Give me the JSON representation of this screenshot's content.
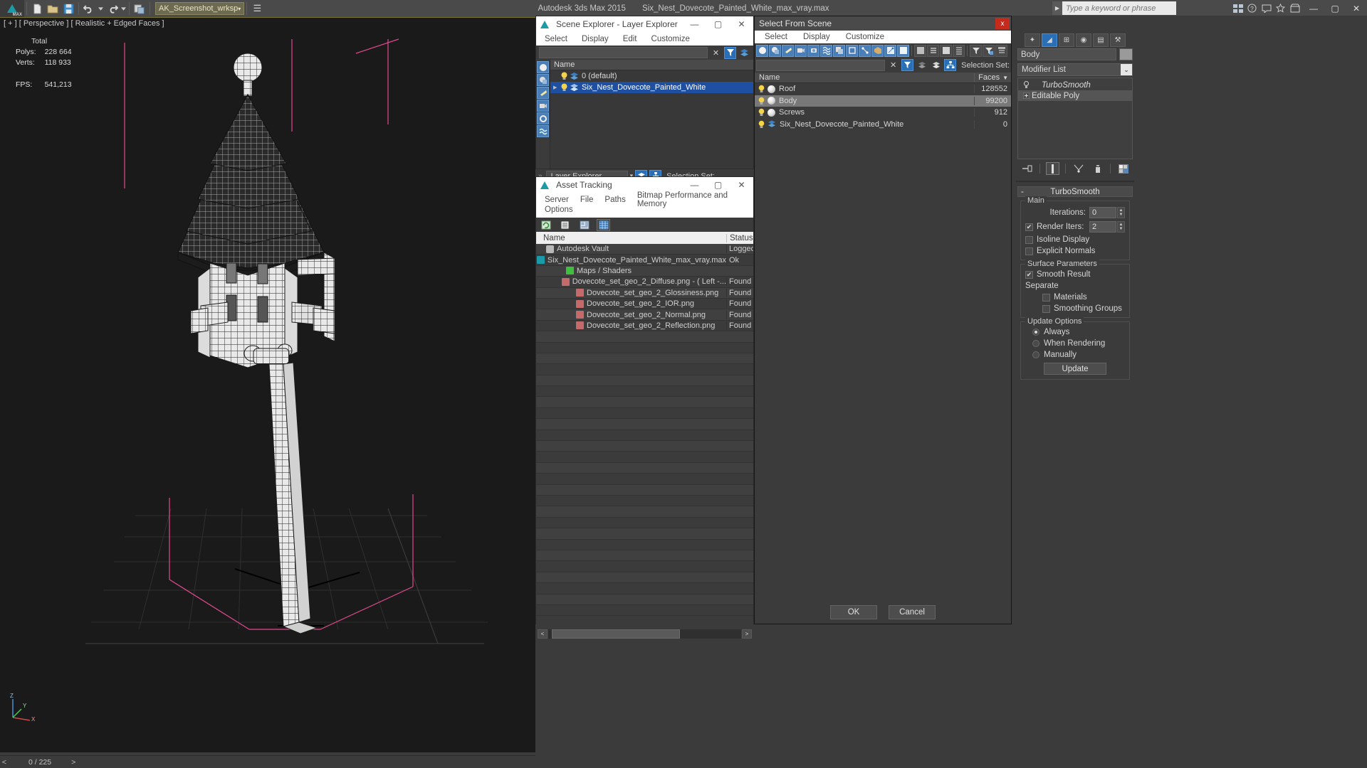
{
  "topbar": {
    "app_logo": "3dsmax-logo-icon",
    "quick_icons": [
      "new-file-icon",
      "open-file-icon",
      "save-file-icon",
      "undo-icon",
      "undo-dropdown-icon",
      "redo-icon",
      "redo-dropdown-icon",
      "select-link-icon"
    ],
    "workspace": "AK_Screenshot_wrksp",
    "title_app": "Autodesk 3ds Max  2015",
    "title_file": "Six_Nest_Dovecote_Painted_White_max_vray.max",
    "search_placeholder": "Type a keyword or phrase",
    "right_icons": [
      "workspaces-icon",
      "help-icon",
      "communication-center-icon",
      "favorites-icon",
      "exchange-store-icon"
    ],
    "window_controls": [
      "minimize-icon",
      "maximize-icon",
      "close-icon"
    ]
  },
  "viewport": {
    "label": "[ + ] [ Perspective ] [ Realistic + Edged Faces ]",
    "stats_header": "Total",
    "stats": [
      {
        "key": "Polys:",
        "value": "228 664"
      },
      {
        "key": "Verts:",
        "value": "118 933"
      },
      {
        "key": "FPS:",
        "value": "541,213"
      }
    ],
    "axis": {
      "z": "Z",
      "y": "Y",
      "x": "X"
    }
  },
  "statusbar": {
    "left_arrow": "<",
    "frame_counter": "0 / 225",
    "right_arrow": ">"
  },
  "scene_explorer": {
    "title": "Scene Explorer - Layer Explorer",
    "icon": "3dsmax-window-icon",
    "menus": [
      "Select",
      "Display",
      "Edit",
      "Customize"
    ],
    "toolbar_icons": [
      "clear-search-icon",
      "filter-icon",
      "layers-icon"
    ],
    "window_controls": [
      "minimize-icon",
      "maximize-icon",
      "close-icon"
    ],
    "rail_icons": [
      "geometry-filter-icon",
      "shapes-filter-icon",
      "lights-filter-icon",
      "cameras-filter-icon",
      "helpers-filter-icon",
      "spacewarps-filter-icon"
    ],
    "column_header": "Name",
    "rows": [
      {
        "name": "0 (default)",
        "selected": false,
        "expandable": false
      },
      {
        "name": "Six_Nest_Dovecote_Painted_White",
        "selected": true,
        "expandable": true
      }
    ],
    "footer_tab": "Layer Explorer",
    "footer_icons": [
      "layers-icon",
      "hierarchy-icon"
    ],
    "selection_set_label": "Selection Set:"
  },
  "asset_tracking": {
    "title": "Asset Tracking",
    "icon": "3dsmax-window-icon",
    "menus": [
      "Server",
      "File",
      "Paths",
      "Bitmap Performance and Memory",
      "Options"
    ],
    "window_controls": [
      "minimize-icon",
      "maximize-icon",
      "close-icon"
    ],
    "toolbar_icons": [
      "refresh-icon",
      "list-view-icon",
      "thumbnail-view-icon",
      "grid-view-icon"
    ],
    "columns": [
      "Name",
      "Status"
    ],
    "rows": [
      {
        "name": "Autodesk Vault",
        "status": "Logged",
        "indent": 1,
        "icon": "vault-icon",
        "icon_color": "#b8b8b8"
      },
      {
        "name": "Six_Nest_Dovecote_Painted_White_max_vray.max",
        "status": "Ok",
        "indent": 2,
        "icon": "max-file-icon",
        "icon_color": "#1b9aa8"
      },
      {
        "name": "Maps / Shaders",
        "status": "",
        "indent": 3,
        "icon": "maps-icon",
        "icon_color": "#3ec03e"
      },
      {
        "name": "Dovecote_set_geo_2_Diffuse.png -  ( Left -...",
        "status": "Found",
        "indent": 4,
        "icon": "bitmap-icon",
        "icon_color": "#c46a6a"
      },
      {
        "name": "Dovecote_set_geo_2_Glossiness.png",
        "status": "Found",
        "indent": 4,
        "icon": "bitmap-icon",
        "icon_color": "#c46a6a"
      },
      {
        "name": "Dovecote_set_geo_2_IOR.png",
        "status": "Found",
        "indent": 4,
        "icon": "bitmap-icon",
        "icon_color": "#c46a6a"
      },
      {
        "name": "Dovecote_set_geo_2_Normal.png",
        "status": "Found",
        "indent": 4,
        "icon": "bitmap-icon",
        "icon_color": "#c46a6a"
      },
      {
        "name": "Dovecote_set_geo_2_Reflection.png",
        "status": "Found",
        "indent": 4,
        "icon": "bitmap-icon",
        "icon_color": "#c46a6a"
      }
    ],
    "empty_row_count": 26,
    "scroll_left": "<",
    "scroll_right": ">"
  },
  "select_from_scene": {
    "title": "Select From Scene",
    "close_label": "x",
    "menus": [
      "Select",
      "Display",
      "Customize"
    ],
    "toolbar_row1": [
      "geometry-filter-icon",
      "shapes-filter-icon",
      "lights-filter-icon",
      "cameras-filter-icon",
      "helpers-filter-icon",
      "spacewarps-filter-icon",
      "groups-filter-icon",
      "xrefs-filter-icon",
      "bones-filter-icon",
      "containers-filter-icon",
      "particles-filter-icon",
      "all-filter-icon",
      "display-none-icon",
      "display-hierarchy-icon",
      "display-flat-icon",
      "display-layers-icon",
      "filter-icon",
      "advanced-filter-icon",
      "column-settings-icon"
    ],
    "toolbar_row2": [
      "clear-search-icon",
      "filter-toggle-icon",
      "layers-toggle-icon",
      "layer-view-icon",
      "hierarchy-view-icon"
    ],
    "selection_set_label": "Selection Set:",
    "columns": {
      "name": "Name",
      "faces": "Faces",
      "sort_indicator": "▼"
    },
    "rows": [
      {
        "name": "Roof",
        "faces": "128552",
        "highlighted": false
      },
      {
        "name": "Body",
        "faces": "99200",
        "highlighted": true
      },
      {
        "name": "Screws",
        "faces": "912",
        "highlighted": false
      },
      {
        "name": "Six_Nest_Dovecote_Painted_White",
        "faces": "0",
        "highlighted": false,
        "is_layer": true
      }
    ],
    "ok_label": "OK",
    "cancel_label": "Cancel"
  },
  "command_panel": {
    "tabs": [
      "create-tab-icon",
      "modify-tab-icon",
      "hierarchy-tab-icon",
      "motion-tab-icon",
      "display-tab-icon",
      "utilities-tab-icon"
    ],
    "active_tab_index": 1,
    "object_name": "Body",
    "modifier_list_label": "Modifier List",
    "modifier_stack": [
      {
        "label": "TurboSmooth",
        "italic": true,
        "icon": "lightbulb-toggle-icon",
        "selected": false
      },
      {
        "label": "Editable Poly",
        "italic": false,
        "icon": "expand-plus-icon",
        "selected": true
      }
    ],
    "stack_tools": [
      "pin-stack-icon",
      "show-end-result-icon",
      "make-unique-icon",
      "remove-modifier-icon",
      "configure-sets-icon"
    ],
    "rollout": {
      "title": "TurboSmooth",
      "collapse_glyph": "-",
      "main": {
        "caption": "Main",
        "iterations_label": "Iterations:",
        "iterations_value": "0",
        "render_iters_label": "Render Iters:",
        "render_iters_value": "2",
        "render_iters_checked": true,
        "isoline_display_label": "Isoline Display",
        "isoline_display_checked": false,
        "explicit_normals_label": "Explicit Normals",
        "explicit_normals_checked": false
      },
      "surface": {
        "caption": "Surface Parameters",
        "smooth_result_label": "Smooth Result",
        "smooth_result_checked": true,
        "separate_label": "Separate",
        "materials_label": "Materials",
        "materials_checked": false,
        "smoothing_groups_label": "Smoothing Groups",
        "smoothing_groups_checked": false
      },
      "update": {
        "caption": "Update Options",
        "options": [
          "Always",
          "When Rendering",
          "Manually"
        ],
        "selected_index": 0,
        "button_label": "Update"
      }
    }
  }
}
